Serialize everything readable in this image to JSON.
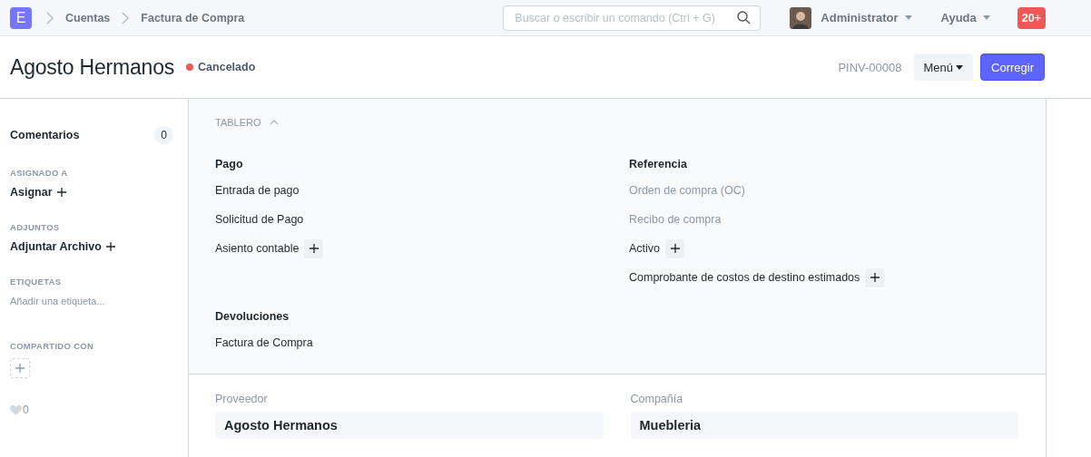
{
  "navbar": {
    "logo": "E",
    "breadcrumbs": [
      "Cuentas",
      "Factura de Compra"
    ],
    "search": {
      "placeholder": "Buscar o escribir un comando (Ctrl + G)"
    },
    "user": "Administrator",
    "help": "Ayuda",
    "notifications": "20+"
  },
  "page_head": {
    "title": "Agosto Hermanos",
    "status": {
      "label": "Cancelado",
      "color": "#f25757"
    },
    "doc_id": "PINV-00008",
    "menu_button": "Menú",
    "primary_button": "Corregir"
  },
  "sidebar": {
    "comments": {
      "label": "Comentarios",
      "count": "0"
    },
    "sections": [
      {
        "kind": "action",
        "heading": "ASIGNADO A",
        "label": "Asignar"
      },
      {
        "kind": "action",
        "heading": "ADJUNTOS",
        "label": "Adjuntar Archivo"
      },
      {
        "kind": "tags",
        "heading": "ETIQUETAS",
        "label": "Añadir una etiqueta..."
      },
      {
        "kind": "share",
        "heading": "COMPARTIDO CON"
      }
    ],
    "likes": "0"
  },
  "dashboard": {
    "title": "TABLERO",
    "expanded": true,
    "groups": [
      {
        "heading": "Pago",
        "links": [
          {
            "label": "Entrada de pago",
            "muted": false,
            "add": false
          },
          {
            "label": "Solicitud de Pago",
            "muted": false,
            "add": false
          },
          {
            "label": "Asiento contable",
            "muted": false,
            "add": true
          }
        ]
      },
      {
        "heading": "Referencia",
        "links": [
          {
            "label": "Orden de compra (OC)",
            "muted": true,
            "add": false
          },
          {
            "label": "Recibo de compra",
            "muted": true,
            "add": false
          },
          {
            "label": "Activo",
            "muted": false,
            "add": true
          },
          {
            "label": "Comprobante de costos de destino estimados",
            "muted": false,
            "add": true
          }
        ]
      },
      {
        "heading": "Devoluciones",
        "links": [
          {
            "label": "Factura de Compra",
            "muted": false,
            "add": false
          }
        ]
      }
    ]
  },
  "form": {
    "fields": [
      {
        "label": "Proveedor",
        "value": "Agosto Hermanos"
      },
      {
        "label": "Compañía",
        "value": "Muebleria"
      }
    ]
  }
}
